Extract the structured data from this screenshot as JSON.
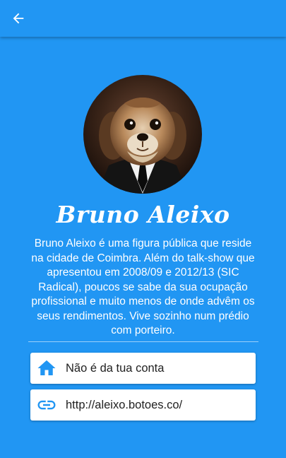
{
  "app_bar": {
    "back_icon": "arrow-back-icon",
    "color": "#2196f3"
  },
  "profile": {
    "avatar": "dog-in-suit-avatar",
    "name": "Bruno Aleixo",
    "bio": "Bruno Aleixo é uma figura pública que reside na cidade de Coimbra. Além do talk-show que apresentou em 2008/09 e 2012/13 (SIC Radical), poucos se sabe da sua ocupação profissional e muito menos de onde advêm os seus rendimentos. Vive sozinho num prédio com porteiro."
  },
  "info_cards": [
    {
      "icon": "home-icon",
      "label": "Não é da tua conta"
    },
    {
      "icon": "link-icon",
      "label": "http://aleixo.botoes.co/"
    }
  ],
  "colors": {
    "background": "#2196f3",
    "card": "#ffffff",
    "icon_accent": "#2196f3"
  }
}
